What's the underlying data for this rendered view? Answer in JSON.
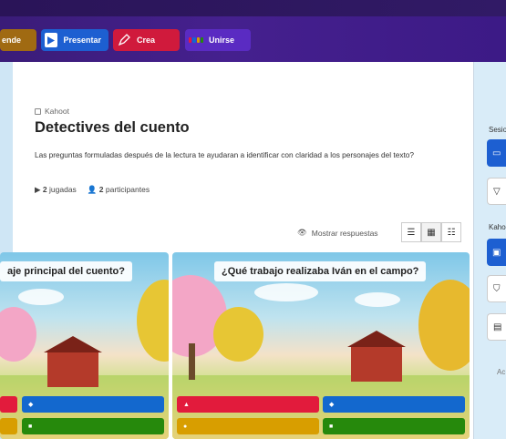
{
  "nav": {
    "aprende_label": "ende",
    "presentar_label": "Presentar",
    "crea_label": "Crea",
    "unirse_label": "Unirse"
  },
  "kahoot": {
    "breadcrumb": "Kahoot",
    "title": "Detectives del cuento",
    "description": "Las preguntas formuladas después de la lectura te ayudaran a identificar con claridad a los personajes del texto?",
    "plays_count": "2",
    "plays_label": "jugadas",
    "participants_count": "2",
    "participants_label": "participantes"
  },
  "toolbar": {
    "show_answers_label": "Mostrar respuestas"
  },
  "questions": [
    {
      "text": "aje principal del cuento?"
    },
    {
      "text": "¿Qué trabajo realizaba Iván en el campo?"
    }
  ],
  "sidebar": {
    "section1_label": "Sesio",
    "section2_label": "Kaho",
    "section3_label": "Ac"
  },
  "colors": {
    "nav_purple": "#45208e",
    "presentar_blue": "#1d5fd1",
    "crea_red": "#d01a3c",
    "answer_red": "#e21b3c",
    "answer_blue": "#1368ce",
    "answer_yellow": "#d89e00",
    "answer_green": "#26890c"
  }
}
